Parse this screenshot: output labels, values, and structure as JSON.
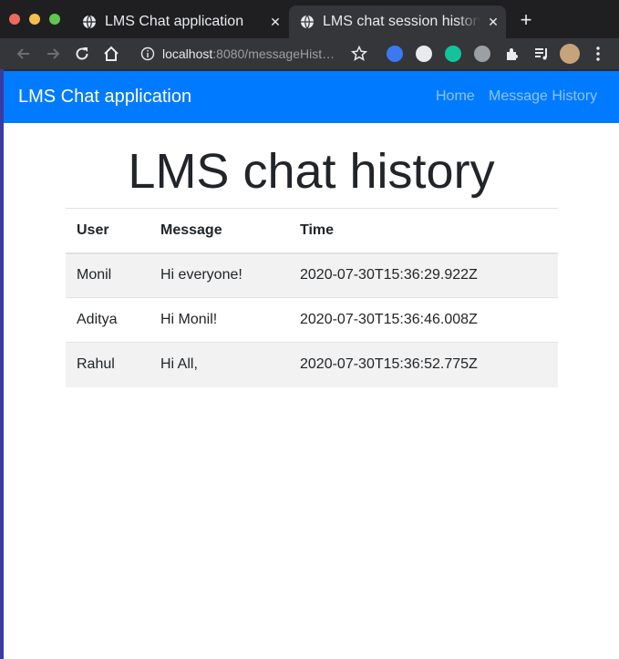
{
  "browser": {
    "tabs": [
      {
        "title": "LMS Chat application",
        "close": "✕"
      },
      {
        "title": "LMS chat session history",
        "close": "✕"
      }
    ],
    "new_tab": "+",
    "address": {
      "host": "localhost",
      "path": ":8080/messageHist…"
    }
  },
  "navbar": {
    "brand": "LMS Chat application",
    "links": [
      "Home",
      "Message History"
    ],
    "color": "#007bff"
  },
  "page": {
    "title": "LMS chat history",
    "table": {
      "headers": [
        "User",
        "Message",
        "Time"
      ],
      "rows": [
        {
          "user": "Monil",
          "message": "Hi everyone!",
          "time": "2020-07-30T15:36:29.922Z"
        },
        {
          "user": "Aditya",
          "message": "Hi Monil!",
          "time": "2020-07-30T15:36:46.008Z"
        },
        {
          "user": "Rahul",
          "message": "Hi All,",
          "time": "2020-07-30T15:36:52.775Z"
        }
      ]
    }
  }
}
